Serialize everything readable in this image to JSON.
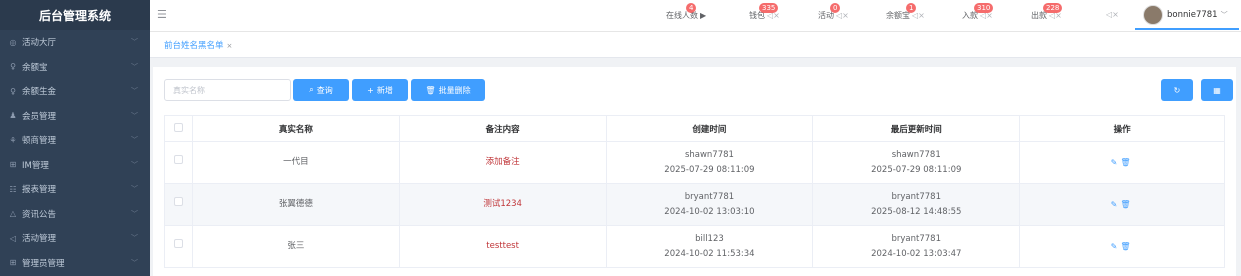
{
  "app_title": "后台管理系统",
  "sidebar": {
    "items": [
      {
        "icon": "◎",
        "label": "活动大厅"
      },
      {
        "icon": "♀",
        "label": "余额宝"
      },
      {
        "icon": "♀",
        "label": "余额生金"
      },
      {
        "icon": "♟",
        "label": "会员管理"
      },
      {
        "icon": "⚘",
        "label": "顿商管理"
      },
      {
        "icon": "⊞",
        "label": "IM管理"
      },
      {
        "icon": "☷",
        "label": "报表管理"
      },
      {
        "icon": "△",
        "label": "资讯公告"
      },
      {
        "icon": "◁",
        "label": "活动管理"
      },
      {
        "icon": "⊞",
        "label": "管理员管理"
      }
    ]
  },
  "header": {
    "stats": [
      {
        "label": "在线人数",
        "badge": "4"
      },
      {
        "label": "钱包",
        "badge": "335"
      },
      {
        "label": "活动",
        "badge": "0"
      },
      {
        "label": "余额宝",
        "badge": "1"
      },
      {
        "label": "入款",
        "badge": "310"
      },
      {
        "label": "出款",
        "badge": "228"
      }
    ],
    "username": "bonnie7781"
  },
  "tab": {
    "label": "前台姓名黑名单",
    "close": "×"
  },
  "toolbar": {
    "search_placeholder": "真实名称",
    "query_label": "查询",
    "add_label": "新增",
    "batch_delete_label": "批量删除"
  },
  "table": {
    "headers": [
      "真实名称",
      "备注内容",
      "创建时间",
      "最后更新时间",
      "操作"
    ],
    "rows": [
      {
        "name": "一代目",
        "note": "添加备注",
        "creator": "shawn7781",
        "created": "2025-07-29 08:11:09",
        "updater": "shawn7781",
        "updated": "2025-07-29 08:11:09"
      },
      {
        "name": "张翼德德",
        "note": "测试1234",
        "creator": "bryant7781",
        "created": "2024-10-02 13:03:10",
        "updater": "bryant7781",
        "updated": "2025-08-12 14:48:55"
      },
      {
        "name": "张三",
        "note": "testtest",
        "creator": "bill123",
        "created": "2024-10-02 11:53:34",
        "updater": "bryant7781",
        "updated": "2024-10-02 13:03:47"
      }
    ]
  }
}
